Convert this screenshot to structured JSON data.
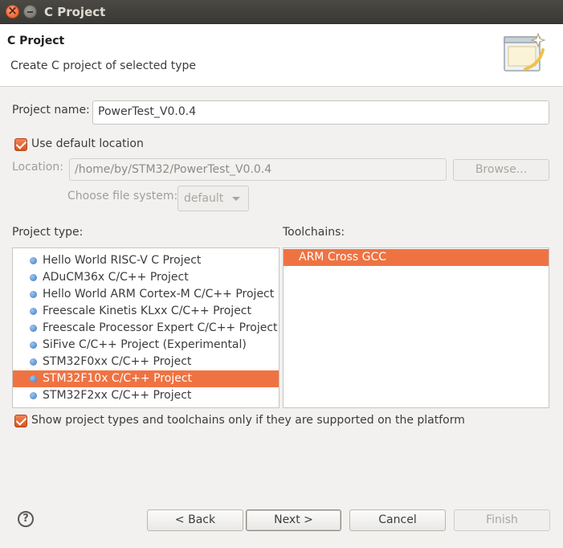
{
  "window": {
    "title": "C Project"
  },
  "header": {
    "title": "C Project",
    "description": "Create C project of selected type",
    "icon": "wizard-banner-icon"
  },
  "form": {
    "project_name_label": "Project name:",
    "project_name_value": "PowerTest_V0.0.4",
    "use_default_location_label": "Use default location",
    "use_default_location_checked": true,
    "location_label": "Location:",
    "location_value": "/home/by/STM32/PowerTest_V0.0.4",
    "browse_label": "Browse...",
    "file_system_label": "Choose file system:",
    "file_system_value": "default"
  },
  "project_types": {
    "label": "Project type:",
    "items": [
      "Hello World RISC-V C Project",
      "ADuCM36x C/C++ Project",
      "Hello World ARM Cortex-M C/C++ Project",
      "Freescale Kinetis KLxx C/C++ Project",
      "Freescale Processor Expert C/C++ Project",
      "SiFive C/C++ Project (Experimental)",
      "STM32F0xx C/C++ Project",
      "STM32F10x C/C++ Project",
      "STM32F2xx C/C++ Project"
    ],
    "selected": "STM32F10x C/C++ Project"
  },
  "toolchains": {
    "label": "Toolchains:",
    "items": [
      "ARM Cross GCC"
    ],
    "selected": "ARM Cross GCC"
  },
  "filter": {
    "label": "Show project types and toolchains only if they are supported on the platform",
    "checked": true
  },
  "footer": {
    "help_icon": "?",
    "back_label": "< Back",
    "next_label": "Next >",
    "cancel_label": "Cancel",
    "finish_label": "Finish"
  },
  "colors": {
    "accent": "#ef7342",
    "titlebar": "#3c3b37"
  }
}
